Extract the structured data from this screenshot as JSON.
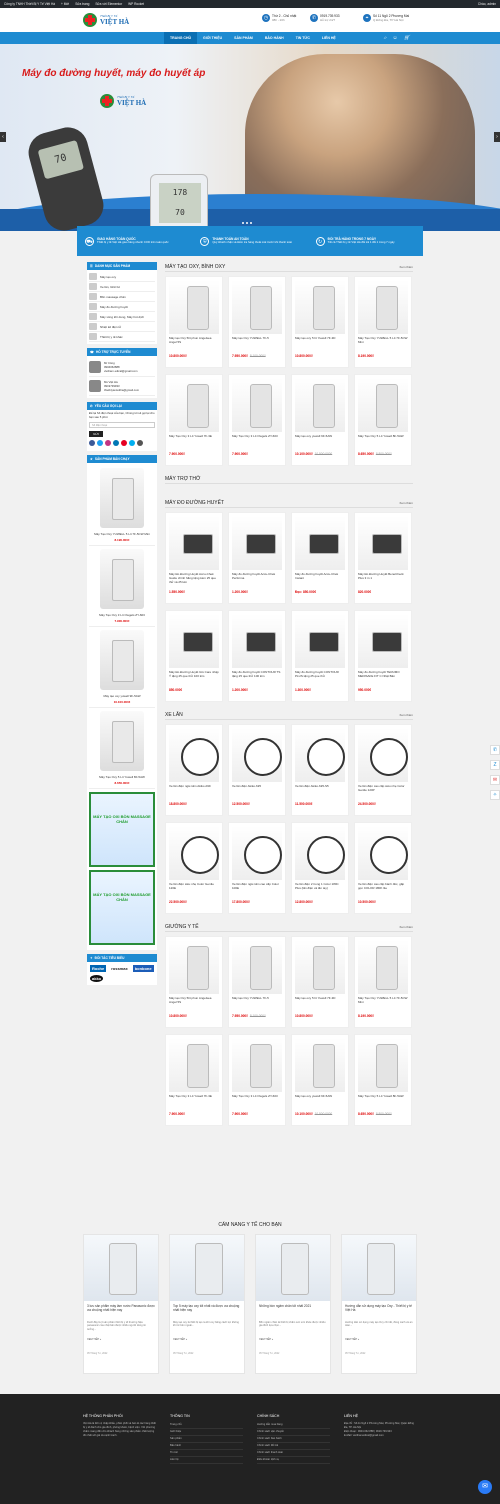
{
  "wpbar": {
    "items": [
      "Công ty TNHH Thiết Bị Y Tế Việt Hà",
      "0",
      "+ Mới",
      "Sửa trang",
      "Sửa với Elementor",
      "WP Rocket"
    ],
    "greeting": "Chào, admin"
  },
  "header": {
    "logo_small": "Thiết Bị Y Tế",
    "logo_big": "VIỆT HÀ",
    "logo_sub": "VietHa",
    "hours_l1": "Thứ 2 - Chủ nhật",
    "hours_l2": "08h - 20h",
    "phone_l1": "0919.739.933",
    "phone_l2": "Hỗ trợ 24/7",
    "addr_l1": "Số 11 Ngõ 2 Phương Mai",
    "addr_l2": "Q Đống Đa, TP Hà Nội"
  },
  "nav": {
    "items": [
      "TRANG CHỦ",
      "GIỚI THIỆU",
      "SẢN PHẨM",
      "BẢO HÀNH",
      "TIN TỨC",
      "LIÊN HỆ"
    ],
    "cart_count": "0"
  },
  "hero": {
    "title": "Máy đo đường huyết, máy đo huyết áp",
    "logo_small": "Thiết Bị Y Tế",
    "logo_big": "VIỆT HÀ",
    "logo_sub": "VietHa",
    "meter_value": "70",
    "bp_line1": "178",
    "bp_line2": "70"
  },
  "features": [
    {
      "title": "GIAO HÀNG TOÀN QUỐC",
      "text": "Thiết bị y tế Việt Hà giao hàng nhanh COD trên toàn quốc"
    },
    {
      "title": "THANH TOÁN AN TOÀN",
      "text": "Quý khách nhận và kiểm tra hàng thoải mái trước khi thanh toán"
    },
    {
      "title": "ĐỔI TRẢ HÀNG TRONG 7 NGÀY",
      "text": "Tất cả Thiết bị y tế Việt Hà đổi trả 1 đổi 1 trong 7 ngày"
    }
  ],
  "sidebar": {
    "cat_title": "DANH MỤC SẢN PHẨM",
    "cats": [
      "Máy tạo oxy",
      "Xe lăn, Ghế bô",
      "Bồn massage chân",
      "Máy đo đường huyết",
      "Máy xông khí dung, Máy hút dịch",
      "Nhiệt kế điện tử",
      "Thiết bị y tế khác"
    ],
    "support_title": "HỖ TRỢ TRỰC TUYẾN",
    "supports": [
      {
        "name": "Mr Công",
        "phone": "0904062888",
        "email": "vietham edical@gmail.com"
      },
      {
        "name": "Ms Việt Hà",
        "phone": "0919739933",
        "email": "thietbiyteviettha@gmail.com"
      }
    ],
    "consult_title": "YÊU CẦU GỌI LẠI",
    "consult_text": "Để lại Số điện thoại của bạn, Chúng tôi sẽ gọi lại cho bạn sau 5 phút",
    "consult_placeholder": "Số điện thoại",
    "consult_btn": "GỬI",
    "best_title": "SẢN PHẨM BÁN CHẠY",
    "best": [
      {
        "name": "Máy Tạo Oxy YUWELL 5 Lít 7F-5CW Mini",
        "price": "8.190.000₫"
      },
      {
        "name": "Máy Tạo Oxy 3 Lít Owgels ZY-603",
        "price": "7.900.000₫"
      },
      {
        "name": "Máy tạo oxy yuwell 9F-5AW",
        "price": "10.100.000₫"
      },
      {
        "name": "Máy Tạo Oxy 5 Lít Yuwell 8F-5AW",
        "price": "8.650.000₫"
      }
    ],
    "ads": [
      "MÁY TẠO OXI BỒN MASSAGE CHÂN",
      "MÁY TẠO OXI BỒN MASSAGE CHÂN"
    ],
    "partners_title": "ĐỐI TÁC TIÊU BIỂU",
    "partners": [
      "Roche",
      "rossmax",
      "bonbone",
      "akko"
    ]
  },
  "sections": [
    {
      "title": "MÁY TẠO OXY, BÌNH OXY",
      "more": "Xem thêm",
      "products": [
        {
          "name": "Máy tạo Oxy 5lít phun Angelsea Angel 5S",
          "price": "10.800.000₫",
          "old": ""
        },
        {
          "name": "Máy tạo Oxy YUWELL 7F-5",
          "price": "7.950.000₫",
          "old": "8.100.000₫"
        },
        {
          "name": "Máy tạo oxy 5 lít Yuwell 7F-3D",
          "price": "10.800.000₫",
          "old": ""
        },
        {
          "name": "Máy Tạo Oxy YUWELL 5 Lít 7F-5CW Mini",
          "price": "8.190.000₫",
          "old": ""
        },
        {
          "name": "Máy Tạo Oxy 3 Lít Yuwell 7F-3E",
          "price": "7.900.000₫",
          "old": ""
        },
        {
          "name": "Máy Tạo Oxy 3 Lít Owgels ZY-603",
          "price": "7.900.000₫",
          "old": ""
        },
        {
          "name": "Máy tạo oxy yuwell 9F-5AW",
          "price": "10.100.000₫",
          "old": "10.500.000₫"
        },
        {
          "name": "Máy Tạo Oxy 5 Lít Yuwell 8F-5AW",
          "price": "8.650.000₫",
          "old": "8.800.000₫"
        }
      ]
    },
    {
      "title": "MÁY TRỢ THỞ",
      "more": "",
      "products": []
    },
    {
      "title": "MÁY ĐO ĐƯỜNG HUYẾT",
      "more": "Xem thêm",
      "products": [
        {
          "name": "Máy Đo Đường Huyết Accu-Chek Guide chính hãng tặng kèm 25 que thử và 25 kim",
          "price": "1.550.000₫",
          "old": ""
        },
        {
          "name": "Máy đo đường huyết Accu-Chek Performa",
          "price": "1.200.000₫",
          "old": ""
        },
        {
          "name": "Máy đo đường huyết Accu-Chek Instant",
          "price": "Đọc: 850.000₫",
          "old": ""
        },
        {
          "name": "Máy Đo Đường Huyết BeneCheck Plus 3 in 1",
          "price": "820.000₫",
          "old": ""
        },
        {
          "name": "Máy Đo Đường Huyết GG Care nhập Ý tặng 25 que thử 100 kim",
          "price": "850.000₫",
          "old": ""
        },
        {
          "name": "Máy đo đường huyết CONTOUR TS tặng 25 que thử 100 kim",
          "price": "1.200.000₫",
          "old": ""
        },
        {
          "name": "Máy đo đường huyết CONTOUR PLUS tặng 25 que thử",
          "price": "1.300.000₫",
          "old": ""
        },
        {
          "name": "Máy đo đường huyết TERUMO MEDISAFE FIT C Nhật Bản",
          "price": "950.000₫",
          "old": ""
        }
      ]
    },
    {
      "title": "XE LĂN",
      "more": "Xem thêm",
      "products": [
        {
          "name": "Xe lăn điện ngả nằm Akiko A99",
          "price": "18.800.000₫",
          "old": ""
        },
        {
          "name": "Xe lăn điện Akiko A95",
          "price": "12.500.000₫",
          "old": ""
        },
        {
          "name": "Xe lăn điện Akiko A95-S5",
          "price": "11.500.000₫",
          "old": ""
        },
        {
          "name": "Xe lăn điện cao cấp siêu nhẹ Color Gentle 120P",
          "price": "24.500.000₫",
          "old": ""
        },
        {
          "name": "Xe lăn điện siêu nhẹ Color Gentle 120E",
          "price": "22.500.000₫",
          "old": ""
        },
        {
          "name": "Xe lăn điện ngả nằm cao cấp Color 100E",
          "price": "17.800.000₫",
          "old": ""
        },
        {
          "name": "Xe lăn điện 2 trong 1 Color 180C Plus (lăn điện và lăn tay)",
          "price": "12.800.000₫",
          "old": ""
        },
        {
          "name": "Xe lăn điện cao cấp bánh đúc, gấp gọn COLOR 180K lite",
          "price": "10.500.000₫",
          "old": ""
        }
      ]
    },
    {
      "title": "GIƯỜNG Y TẾ",
      "more": "Xem thêm",
      "products": [
        {
          "name": "Máy tạo Oxy 5lít phun Angelsea Angel 5S",
          "price": "10.800.000₫",
          "old": ""
        },
        {
          "name": "Máy tạo Oxy YUWELL 7F-5",
          "price": "7.950.000₫",
          "old": "8.100.000₫"
        },
        {
          "name": "Máy tạo oxy 5 lít Yuwell 7F-3D",
          "price": "10.800.000₫",
          "old": ""
        },
        {
          "name": "Máy Tạo Oxy YUWELL 5 Lít 7F-5CW Mini",
          "price": "8.190.000₫",
          "old": ""
        },
        {
          "name": "Máy Tạo Oxy 3 Lít Yuwell 7F-3E",
          "price": "7.900.000₫",
          "old": ""
        },
        {
          "name": "Máy Tạo Oxy 3 Lít Owgels ZY-603",
          "price": "7.900.000₫",
          "old": ""
        },
        {
          "name": "Máy tạo oxy yuwell 9F-5AW",
          "price": "10.100.000₫",
          "old": "10.500.000₫"
        },
        {
          "name": "Máy Tạo Oxy 5 Lít Yuwell 8F-5AW",
          "price": "8.650.000₫",
          "old": "8.800.000₫"
        }
      ]
    }
  ],
  "blog": {
    "title": "CẨM NANG Y TẾ CHO BẠN",
    "posts": [
      {
        "title": "3 lưu sản phẩm máy làm nước Panasonic được ưa chuộng nhất hiện nay",
        "excerpt": "Dưới đây là 3 sản phẩm thiết bị y tế thương hiệu panasonic của nhật bản được nhiều người dùng tin tưởng...",
        "more": "XEM TIẾP »",
        "date": "05 Tháng Tư, 2022"
      },
      {
        "title": "Top 5 máy tạo oxy tốt nhất và được ưa chuộng nhất hiện nay",
        "excerpt": "Máy tạo oxy là thiết bị tạo ra khí oxy bằng cách lọc không khí từ bên ngoài...",
        "more": "XEM TIẾP »",
        "date": "05 Tháng Tư, 2022"
      },
      {
        "title": "Những bồn ngâm chân tốt nhất 2021",
        "excerpt": "Bồn ngâm chân là thiết bị chăm sóc sức khỏe được nhiều gia đình lựa chọn...",
        "more": "XEM TIẾP »",
        "date": "05 Tháng Tư, 2022"
      },
      {
        "title": "Hướng dẫn sử dụng máy tạo Oxy - Thiết bị y tế Việt Hà",
        "excerpt": "Hướng dẫn sử dụng máy tạo Oxy chi tiết, đúng cách và an toàn...",
        "more": "XEM TIẾP »",
        "date": "05 Tháng Tư, 2022"
      }
    ]
  },
  "footer": {
    "c1_title": "HỆ THỐNG PHÂN PHỐI",
    "c1_text": "Việt Hà là đơn vị nhập khẩu, phân phối và bán lẻ các hàng thiết bị y tế dành cho gia đình, phòng khám, bệnh viện. Với phương châm mang đến cho khách hàng những sản phẩm chất lượng tốt nhất với giá cả cạnh tranh.",
    "c2_title": "THÔNG TIN",
    "c2_links": [
      "Trang chủ",
      "Giới thiệu",
      "Sản phẩm",
      "Bảo hành",
      "Tin tức",
      "Liên hệ"
    ],
    "c3_title": "CHÍNH SÁCH",
    "c3_links": [
      "Hướng dẫn mua hàng",
      "Chính sách vận chuyển",
      "Chính sách bảo hành",
      "Chính sách đổi trả",
      "Chính sách thanh toán",
      "Điều khoản dịch vụ"
    ],
    "c4_title": "LIÊN HỆ",
    "addr": "Địa chỉ : Số 11 Ngõ 2 Phương Mai, Phương Mai, Quận Đống Đa, TP. Hà Nội",
    "phone": "Điện thoại : 0904.062.888 | 0919.739.933",
    "email": "E-Mail: vietthamedical@gmail.com"
  }
}
